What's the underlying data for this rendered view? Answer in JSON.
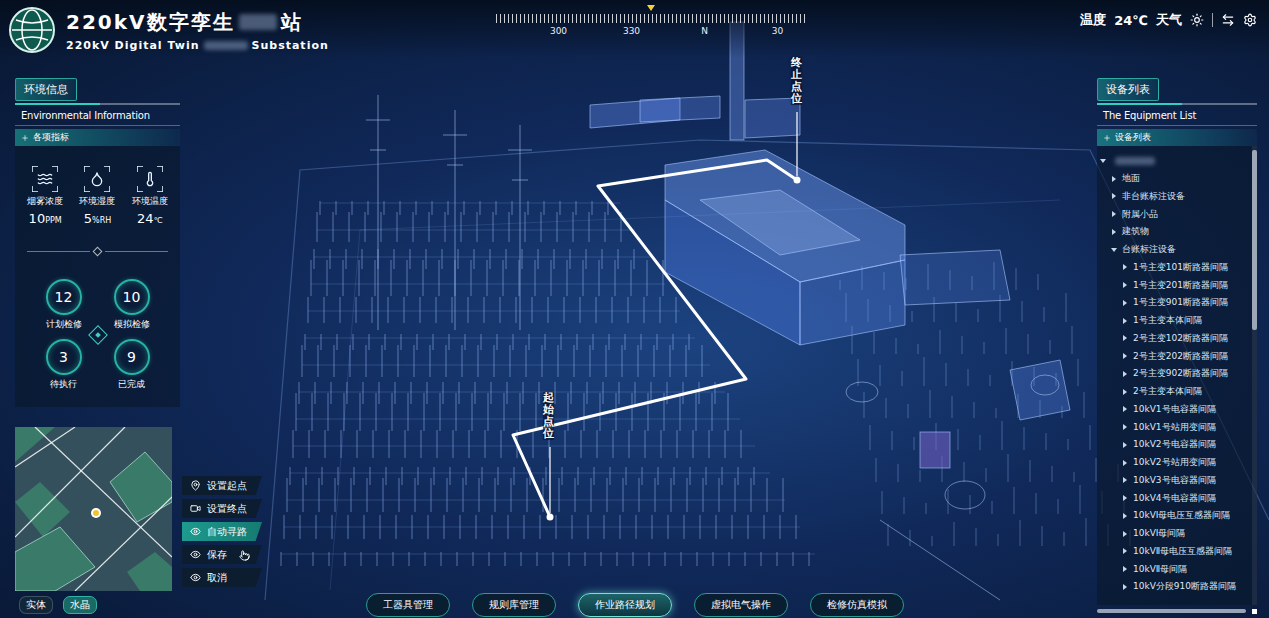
{
  "header": {
    "title_before": "220kV数字孪生",
    "title_after": "站",
    "title_redacted": true,
    "subtitle_before": "220kV Digital Twin",
    "subtitle_after": "Substation",
    "subtitle_redacted": true
  },
  "compass": {
    "labels": [
      "300",
      "330",
      "N",
      "30"
    ]
  },
  "weather": {
    "temperature_label": "温度",
    "temperature": "24℃",
    "weather_label": "天气"
  },
  "environment": {
    "title": "环境信息",
    "subtitle": "Environmental Information",
    "tab": "各项指标",
    "metrics": [
      {
        "label": "烟雾浓度",
        "value": "10",
        "unit": "PPM"
      },
      {
        "label": "环境湿度",
        "value": "5",
        "unit": "%RH"
      },
      {
        "label": "环境温度",
        "value": "24",
        "unit": "℃"
      }
    ],
    "counters": [
      {
        "value": "12",
        "label": "计划检修"
      },
      {
        "value": "10",
        "label": "模拟检修"
      },
      {
        "value": "3",
        "label": "待执行"
      },
      {
        "value": "9",
        "label": "已完成"
      }
    ]
  },
  "path_tools": [
    {
      "label": "设置起点",
      "selected": false,
      "hovered": false
    },
    {
      "label": "设置终点",
      "selected": false,
      "hovered": false
    },
    {
      "label": "自动寻路",
      "selected": true,
      "hovered": false
    },
    {
      "label": "保存",
      "selected": false,
      "hovered": true
    },
    {
      "label": "取消",
      "selected": false,
      "hovered": false
    }
  ],
  "view_modes": [
    {
      "label": "实体",
      "selected": false
    },
    {
      "label": "水晶",
      "selected": true
    }
  ],
  "scene": {
    "start_label": "起始点位",
    "end_label": "终止点位"
  },
  "equipment": {
    "title": "设备列表",
    "subtitle": "The Equipment List",
    "tab": "设备列表",
    "root": {
      "expanded": true,
      "redacted": true
    },
    "tree": [
      {
        "label": "地面",
        "depth": 1,
        "expanded": false
      },
      {
        "label": "非台账标注设备",
        "depth": 1,
        "expanded": false
      },
      {
        "label": "附属小品",
        "depth": 1,
        "expanded": false
      },
      {
        "label": "建筑物",
        "depth": 1,
        "expanded": false
      },
      {
        "label": "台账标注设备",
        "depth": 1,
        "expanded": true
      },
      {
        "label": "1号主变101断路器间隔",
        "depth": 2,
        "expanded": false
      },
      {
        "label": "1号主变201断路器间隔",
        "depth": 2,
        "expanded": false
      },
      {
        "label": "1号主变901断路器间隔",
        "depth": 2,
        "expanded": false
      },
      {
        "label": "1号主变本体间隔",
        "depth": 2,
        "expanded": false
      },
      {
        "label": "2号主变102断路器间隔",
        "depth": 2,
        "expanded": false
      },
      {
        "label": "2号主变202断路器间隔",
        "depth": 2,
        "expanded": false
      },
      {
        "label": "2号主变902断路器间隔",
        "depth": 2,
        "expanded": false
      },
      {
        "label": "2号主变本体间隔",
        "depth": 2,
        "expanded": false
      },
      {
        "label": "10kV1号电容器间隔",
        "depth": 2,
        "expanded": false
      },
      {
        "label": "10kV1号站用变间隔",
        "depth": 2,
        "expanded": false
      },
      {
        "label": "10kV2号电容器间隔",
        "depth": 2,
        "expanded": false
      },
      {
        "label": "10kV2号站用变间隔",
        "depth": 2,
        "expanded": false
      },
      {
        "label": "10kV3号电容器间隔",
        "depth": 2,
        "expanded": false
      },
      {
        "label": "10kV4号电容器间隔",
        "depth": 2,
        "expanded": false
      },
      {
        "label": "10kVⅠ母电压互感器间隔",
        "depth": 2,
        "expanded": false
      },
      {
        "label": "10kVⅠ母间隔",
        "depth": 2,
        "expanded": false
      },
      {
        "label": "10kVⅡ母电压互感器间隔",
        "depth": 2,
        "expanded": false
      },
      {
        "label": "10kVⅡ母间隔",
        "depth": 2,
        "expanded": false
      },
      {
        "label": "10kV分段910断路器间隔",
        "depth": 2,
        "expanded": false
      }
    ]
  },
  "nav": [
    {
      "label": "工器具管理",
      "selected": false
    },
    {
      "label": "规则库管理",
      "selected": false
    },
    {
      "label": "作业路径规划",
      "selected": true
    },
    {
      "label": "虚拟电气操作",
      "selected": false
    },
    {
      "label": "检修仿真模拟",
      "selected": false
    }
  ]
}
